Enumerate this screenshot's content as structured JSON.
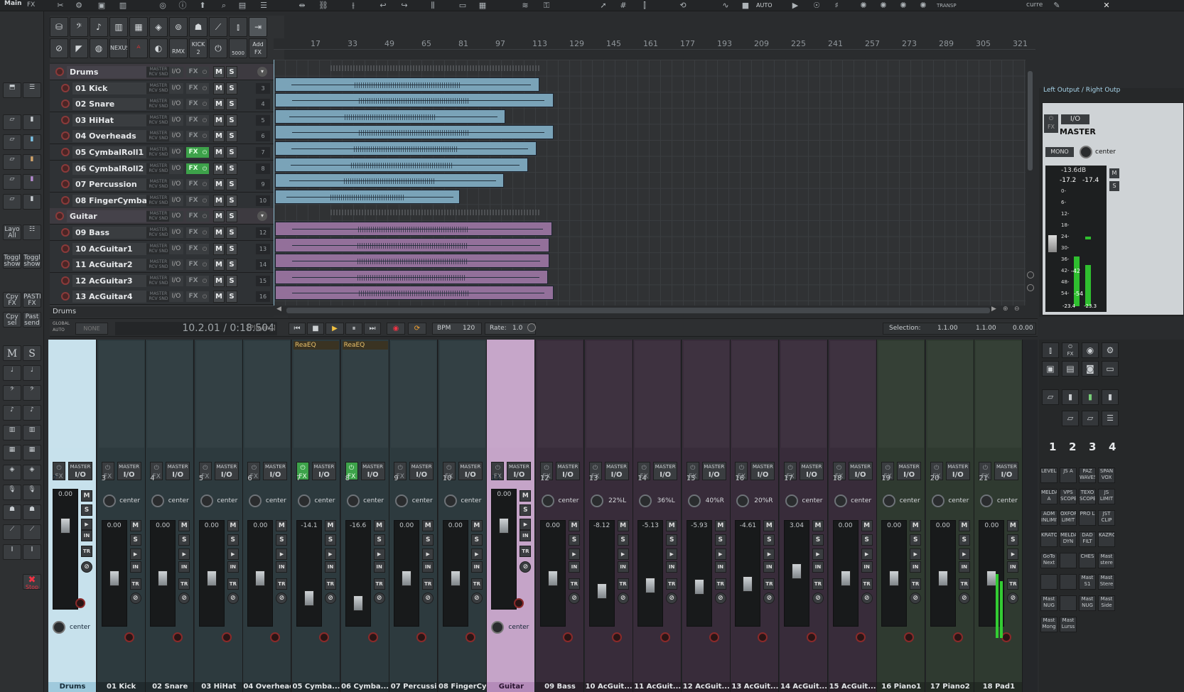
{
  "toolbar": {
    "menu_items": [
      "Main",
      "FX"
    ],
    "auto_label": "AUTO",
    "transp_label": "TRANSP",
    "curre_label": "curre"
  },
  "tcp_tools": {
    "row2_labels": [
      "NEXUS",
      "RMX",
      "KICK 2",
      "5000",
      "Add FX"
    ]
  },
  "tracks": [
    {
      "name": "Drums",
      "num": "",
      "folder": true,
      "fx_on": false,
      "color": "#5a5d60"
    },
    {
      "name": "01 Kick",
      "num": "3",
      "fx_on": false
    },
    {
      "name": "02 Snare",
      "num": "4",
      "fx_on": false
    },
    {
      "name": "03 HiHat",
      "num": "5",
      "fx_on": false
    },
    {
      "name": "04 Overheads",
      "num": "6",
      "fx_on": false
    },
    {
      "name": "05 CymbalRoll1",
      "num": "7",
      "fx_on": true
    },
    {
      "name": "06 CymbalRoll2",
      "num": "8",
      "fx_on": true
    },
    {
      "name": "07 Percussion",
      "num": "9",
      "fx_on": false
    },
    {
      "name": "08 FingerCymbal",
      "num": "10",
      "fx_on": false
    },
    {
      "name": "Guitar",
      "num": "",
      "folder": true,
      "fx_on": false
    },
    {
      "name": "09 Bass",
      "num": "12",
      "fx_on": false
    },
    {
      "name": "10 AcGuitar1",
      "num": "13",
      "fx_on": false
    },
    {
      "name": "11 AcGuitar2",
      "num": "14",
      "fx_on": false
    },
    {
      "name": "12 AcGuitar3",
      "num": "15",
      "fx_on": false
    },
    {
      "name": "13 AcGuitar4",
      "num": "16",
      "fx_on": false
    }
  ],
  "track_labels": {
    "master_rcv": "MASTER RCV SND",
    "io": "I/O",
    "fx": "FX",
    "m": "M",
    "s": "S"
  },
  "tcp_footer": "Drums",
  "ruler": [
    "17",
    "33",
    "49",
    "65",
    "81",
    "97",
    "113",
    "129",
    "145",
    "161",
    "177",
    "193",
    "209",
    "225",
    "241",
    "257",
    "273",
    "289",
    "305",
    "321",
    "33"
  ],
  "left_panel": {
    "layo_all": "Layo All",
    "toggl_show": "Toggl show",
    "toggl_show2": "Toggl show",
    "cpy_fx": "Cpy FX",
    "paste_fx": "PASTE FX",
    "cpy_sel": "Cpy sel",
    "past_send": "Past send",
    "m": "M",
    "s": "S",
    "stop": "Stop"
  },
  "transport": {
    "global_auto": "GLOBAL AUTO",
    "mode": "NONE",
    "position": "10.2.01 / 0:18.504",
    "state": "[Playing]",
    "bpm_label": "BPM",
    "bpm": "120",
    "rate_label": "Rate:",
    "rate": "1.0",
    "selection_label": "Selection:",
    "sel_start": "1.1.00",
    "sel_end": "1.1.00",
    "sel_len": "0.0.00"
  },
  "master": {
    "output": "Left Output / Right Outp",
    "io": "I/O",
    "name": "MASTER",
    "mono": "MONO",
    "pan": "center",
    "peak": "-13.6dB",
    "l": "-17.2",
    "r": "-17.4",
    "scale": [
      "0-",
      "6-",
      "12-",
      "18-",
      "24-",
      "30-",
      "36-",
      "42-",
      "48-",
      "54-"
    ],
    "m": "M",
    "s": "S",
    "meter_l": "-42",
    "meter_m": "-54",
    "meter_l2": "-23.4",
    "meter_r2": "-23.3"
  },
  "mixer": {
    "strips": [
      {
        "name": "Drums",
        "num": "2",
        "vol": "0.00",
        "pan": "center",
        "plug": "",
        "fxon": false,
        "sel": "blue",
        "tint": "#2e3a3e"
      },
      {
        "name": "01 Kick",
        "num": "3",
        "vol": "0.00",
        "pan": "center",
        "plug": "",
        "fxon": false,
        "tint": "#2d3a3e"
      },
      {
        "name": "02 Snare",
        "num": "4",
        "vol": "0.00",
        "pan": "center",
        "plug": "",
        "fxon": false,
        "tint": "#2d3a3e"
      },
      {
        "name": "03 HiHat",
        "num": "5",
        "vol": "0.00",
        "pan": "center",
        "plug": "",
        "fxon": false,
        "tint": "#2d3a3e"
      },
      {
        "name": "04 Overhead",
        "num": "6",
        "vol": "0.00",
        "pan": "center",
        "plug": "",
        "fxon": false,
        "tint": "#2d3a3e"
      },
      {
        "name": "05 Cymba...",
        "num": "7",
        "vol": "-14.1",
        "pan": "center",
        "plug": "ReaEQ",
        "fxon": true,
        "tint": "#2d3a3e"
      },
      {
        "name": "06 Cymba...",
        "num": "8",
        "vol": "-16.6",
        "pan": "center",
        "plug": "ReaEQ",
        "fxon": true,
        "tint": "#2d3a3e"
      },
      {
        "name": "07 Percussi",
        "num": "9",
        "vol": "0.00",
        "pan": "center",
        "plug": "",
        "fxon": false,
        "tint": "#2d3a3e"
      },
      {
        "name": "08 FingerCy",
        "num": "10",
        "vol": "0.00",
        "pan": "center",
        "plug": "",
        "fxon": false,
        "tint": "#2d3a3e"
      },
      {
        "name": "Guitar",
        "num": "11",
        "vol": "0.00",
        "pan": "center",
        "plug": "",
        "fxon": false,
        "sel": "purple",
        "tint": "#3a2e3c"
      },
      {
        "name": "09 Bass",
        "num": "12",
        "vol": "0.00",
        "pan": "center",
        "plug": "",
        "fxon": false,
        "tint": "#382c3a"
      },
      {
        "name": "10 AcGuit...",
        "num": "13",
        "vol": "-8.12",
        "pan": "22%L",
        "plug": "",
        "fxon": false,
        "tint": "#382c3a"
      },
      {
        "name": "11 AcGuit...",
        "num": "14",
        "vol": "-5.13",
        "pan": "36%L",
        "plug": "",
        "fxon": false,
        "tint": "#382c3a"
      },
      {
        "name": "12 AcGuit...",
        "num": "15",
        "vol": "-5.93",
        "pan": "40%R",
        "plug": "",
        "fxon": false,
        "tint": "#382c3a"
      },
      {
        "name": "13 AcGuit...",
        "num": "16",
        "vol": "-4.61",
        "pan": "20%R",
        "plug": "",
        "fxon": false,
        "tint": "#382c3a"
      },
      {
        "name": "14 AcGuit...",
        "num": "17",
        "vol": "3.04",
        "pan": "center",
        "plug": "",
        "fxon": false,
        "tint": "#382c3a"
      },
      {
        "name": "15 AcGuit...",
        "num": "18",
        "vol": "0.00",
        "pan": "center",
        "plug": "",
        "fxon": false,
        "tint": "#382c3a"
      },
      {
        "name": "16 Piano1",
        "num": "19",
        "vol": "0.00",
        "pan": "center",
        "plug": "",
        "fxon": false,
        "tint": "#2f3a30"
      },
      {
        "name": "17 Piano2",
        "num": "20",
        "vol": "0.00",
        "pan": "center",
        "plug": "",
        "fxon": false,
        "tint": "#2f3a30"
      },
      {
        "name": "18 Pad1",
        "num": "21",
        "vol": "0.00",
        "pan": "center",
        "plug": "",
        "fxon": false,
        "tint": "#2f3a30"
      }
    ],
    "labels": {
      "master": "MASTER",
      "io": "I/O",
      "fx": "FX",
      "m": "M",
      "s": "S",
      "in": "IN",
      "tr": "TR"
    }
  },
  "mixside": {
    "nums": [
      "1",
      "2",
      "3",
      "4"
    ],
    "buttons": [
      [
        "LEVELS",
        ""
      ],
      [
        "JS A",
        ""
      ],
      [
        "PAZ WAVES",
        ""
      ],
      [
        "SPAN VOX",
        ""
      ],
      [
        "MELDA A",
        ""
      ],
      [
        "VPS SCOPE",
        ""
      ],
      [
        "TEXO SCOPE",
        ""
      ],
      [
        "JS LIMIT",
        ""
      ],
      [
        "AOM INLIMIT",
        ""
      ],
      [
        "OXFORD LIMIT",
        ""
      ],
      [
        "PRO L",
        ""
      ],
      [
        "JST CLIP",
        ""
      ],
      [
        "KRATOS",
        ""
      ],
      [
        "MELDA DYN",
        ""
      ],
      [
        "DAD FILT",
        ""
      ],
      [
        "KAZROG",
        ""
      ],
      [
        "GoTo Next",
        ""
      ],
      [
        "",
        ""
      ],
      [
        "CHES",
        ""
      ],
      [
        "Mast stere",
        ""
      ],
      [
        "",
        ""
      ],
      [
        "",
        ""
      ],
      [
        "Mast S1",
        ""
      ],
      [
        "Mast Stere",
        ""
      ],
      [
        "Mast NUG",
        ""
      ],
      [
        "",
        ""
      ],
      [
        "Mast NUG",
        ""
      ],
      [
        "Mast Side",
        ""
      ],
      [
        "Mast Mong",
        ""
      ],
      [
        "Mast Lurss",
        ""
      ]
    ]
  },
  "colors": {
    "drums": "#7aa3b8",
    "guitar": "#93709a",
    "fx_on": "#3da24a",
    "accent_sel": "#c7e1ec"
  }
}
